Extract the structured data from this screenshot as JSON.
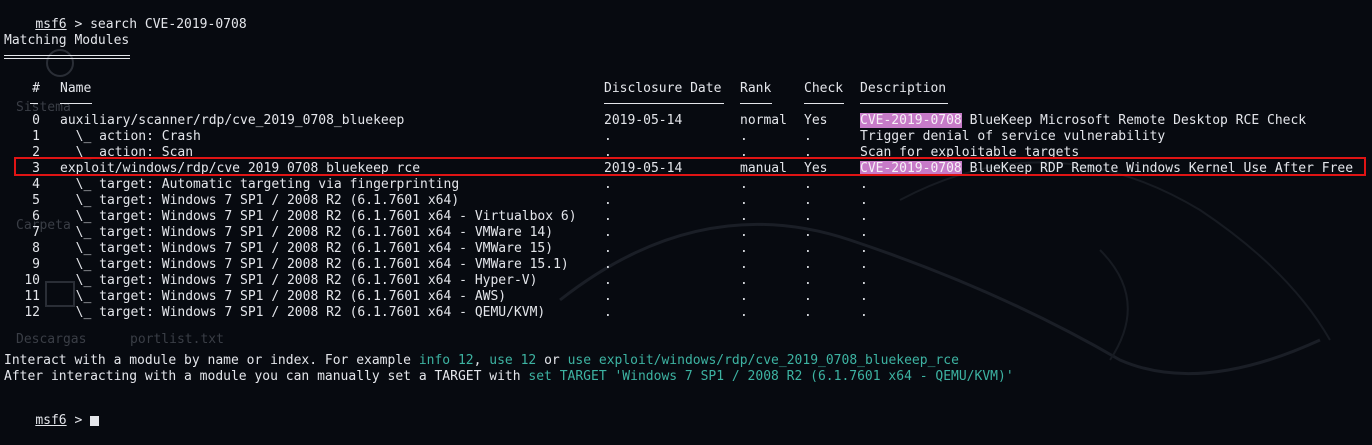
{
  "prompt": {
    "label": "msf6",
    "separator": " > ",
    "command": "search CVE-2019-0708",
    "next_label": "msf6"
  },
  "section_title": "Matching Modules",
  "table": {
    "columns": [
      "#",
      "Name",
      "Disclosure Date",
      "Rank",
      "Check",
      "Description"
    ],
    "rows": [
      {
        "idx": "0",
        "name": "auxiliary/scanner/rdp/cve_2019_0708_bluekeep",
        "date": "2019-05-14",
        "rank": "normal",
        "check": "Yes",
        "desc_hl": "CVE-2019-0708",
        "desc": " BlueKeep Microsoft Remote Desktop RCE Check"
      },
      {
        "idx": "1",
        "name": "  \\_ action: Crash",
        "date": ".",
        "rank": ".",
        "check": ".",
        "desc_hl": "",
        "desc": "Trigger denial of service vulnerability"
      },
      {
        "idx": "2",
        "name": "  \\_ action: Scan",
        "date": ".",
        "rank": ".",
        "check": ".",
        "desc_hl": "",
        "desc": "Scan for exploitable targets"
      },
      {
        "idx": "3",
        "name": "exploit/windows/rdp/cve_2019_0708_bluekeep_rce",
        "date": "2019-05-14",
        "rank": "manual",
        "check": "Yes",
        "desc_hl": "CVE-2019-0708",
        "desc": " BlueKeep RDP Remote Windows Kernel Use After Free"
      },
      {
        "idx": "4",
        "name": "  \\_ target: Automatic targeting via fingerprinting",
        "date": ".",
        "rank": ".",
        "check": ".",
        "desc_hl": "",
        "desc": "."
      },
      {
        "idx": "5",
        "name": "  \\_ target: Windows 7 SP1 / 2008 R2 (6.1.7601 x64)",
        "date": ".",
        "rank": ".",
        "check": ".",
        "desc_hl": "",
        "desc": "."
      },
      {
        "idx": "6",
        "name": "  \\_ target: Windows 7 SP1 / 2008 R2 (6.1.7601 x64 - Virtualbox 6)",
        "date": ".",
        "rank": ".",
        "check": ".",
        "desc_hl": "",
        "desc": "."
      },
      {
        "idx": "7",
        "name": "  \\_ target: Windows 7 SP1 / 2008 R2 (6.1.7601 x64 - VMWare 14)",
        "date": ".",
        "rank": ".",
        "check": ".",
        "desc_hl": "",
        "desc": "."
      },
      {
        "idx": "8",
        "name": "  \\_ target: Windows 7 SP1 / 2008 R2 (6.1.7601 x64 - VMWare 15)",
        "date": ".",
        "rank": ".",
        "check": ".",
        "desc_hl": "",
        "desc": "."
      },
      {
        "idx": "9",
        "name": "  \\_ target: Windows 7 SP1 / 2008 R2 (6.1.7601 x64 - VMWare 15.1)",
        "date": ".",
        "rank": ".",
        "check": ".",
        "desc_hl": "",
        "desc": "."
      },
      {
        "idx": "10",
        "name": "  \\_ target: Windows 7 SP1 / 2008 R2 (6.1.7601 x64 - Hyper-V)",
        "date": ".",
        "rank": ".",
        "check": ".",
        "desc_hl": "",
        "desc": "."
      },
      {
        "idx": "11",
        "name": "  \\_ target: Windows 7 SP1 / 2008 R2 (6.1.7601 x64 - AWS)",
        "date": ".",
        "rank": ".",
        "check": ".",
        "desc_hl": "",
        "desc": "."
      },
      {
        "idx": "12",
        "name": "  \\_ target: Windows 7 SP1 / 2008 R2 (6.1.7601 x64 - QEMU/KVM)",
        "date": ".",
        "rank": ".",
        "check": ".",
        "desc_hl": "",
        "desc": "."
      }
    ]
  },
  "footer": {
    "line1_a": "Interact with a module by name or index. For example ",
    "line1_b": "info 12",
    "line1_c": ", ",
    "line1_d": "use 12",
    "line1_e": " or ",
    "line1_f": "use exploit/windows/rdp/cve_2019_0708_bluekeep_rce",
    "line2_a": "After interacting with a module you can manually set a TARGET with ",
    "line2_b": "set TARGET 'Windows 7 SP1 / 2008 R2 (6.1.7601 x64 - QEMU/KVM)'"
  },
  "desktop_labels": {
    "label_a": "Sistema",
    "label_b": "Carpeta",
    "label_c": "Descargas",
    "label_d": "portlist.txt"
  },
  "colors": {
    "background": "#070a10",
    "text": "#e4e6eb",
    "highlight": "#c77bc8",
    "green": "#3db3a2",
    "selection_box": "#e01414"
  }
}
